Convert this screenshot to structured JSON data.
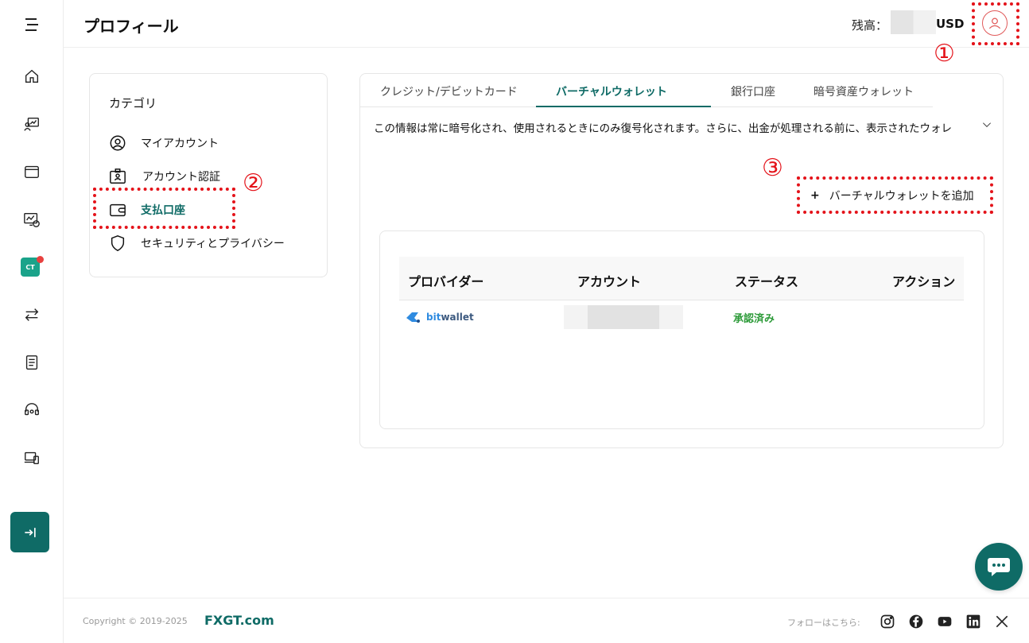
{
  "header": {
    "title": "プロフィール",
    "balance_label": "残高：",
    "currency": "USD"
  },
  "annotations": {
    "one": "①",
    "two": "②",
    "three": "③"
  },
  "sidebar": {
    "items": [
      {
        "icon": "menu-icon"
      },
      {
        "icon": "home-icon"
      },
      {
        "icon": "accounts-icon"
      },
      {
        "icon": "wallet-icon"
      },
      {
        "icon": "trading-icon"
      },
      {
        "icon": "copy-trade-icon",
        "label": "CT"
      },
      {
        "icon": "transfer-icon"
      },
      {
        "icon": "document-icon"
      },
      {
        "icon": "support-icon"
      },
      {
        "icon": "platform-icon"
      }
    ],
    "collapse_icon": "collapse-icon"
  },
  "category": {
    "title": "カテゴリ",
    "items": [
      {
        "label": "マイアカウント",
        "icon": "user-circle-icon"
      },
      {
        "label": "アカウント認証",
        "icon": "id-card-icon"
      },
      {
        "label": "支払口座",
        "icon": "wallet-icon",
        "active": true
      },
      {
        "label": "セキュリティとプライバシー",
        "icon": "shield-icon"
      }
    ]
  },
  "tabs": [
    {
      "label": "クレジット/デビットカード"
    },
    {
      "label": "バーチャルウォレット",
      "active": true
    },
    {
      "label": "銀行口座"
    },
    {
      "label": "暗号資産ウォレット"
    }
  ],
  "notice": "この情報は常に暗号化され、使用されるときにのみ復号化されます。さらに、出金が処理される前に、表示されたウォレ",
  "add_button": {
    "icon": "+",
    "label": "バーチャルウォレットを追加"
  },
  "table": {
    "headers": [
      "プロバイダー",
      "アカウント",
      "ステータス",
      "アクション"
    ],
    "rows": [
      {
        "provider_prefix": "bit",
        "provider_suffix": "wallet",
        "status": "承認済み"
      }
    ]
  },
  "footer": {
    "copyright": "Copyright © 2019-2025",
    "brand": "FXGT.com",
    "follow": "フォローはこちら:",
    "social": [
      "instagram-icon",
      "facebook-icon",
      "youtube-icon",
      "linkedin-icon",
      "x-icon"
    ]
  },
  "colors": {
    "brand": "#0f6b66",
    "annotation": "#e4131a",
    "approved": "#2e9b3a"
  }
}
